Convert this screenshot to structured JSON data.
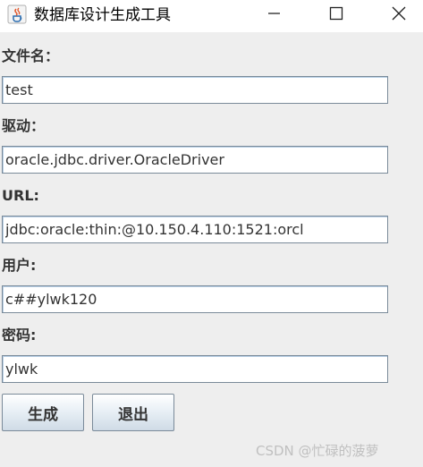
{
  "window": {
    "title": "数据库设计生成工具"
  },
  "form": {
    "filename": {
      "label": "文件名：",
      "value": "test"
    },
    "driver": {
      "label": "驱动：",
      "value": "oracle.jdbc.driver.OracleDriver"
    },
    "url": {
      "label": "URL:",
      "value": "jdbc:oracle:thin:@10.150.4.110:1521:orcl"
    },
    "user": {
      "label": "用户:",
      "value": "c##ylwk120"
    },
    "password": {
      "label": "密码:",
      "value": "ylwk"
    }
  },
  "buttons": {
    "generate": "生成",
    "exit": "退出"
  },
  "watermark": "CSDN @忙碌的菠萝",
  "icons": {
    "app": "java-coffee-cup-icon",
    "minimize": "minimize-icon",
    "maximize": "maximize-icon",
    "close": "close-icon"
  }
}
